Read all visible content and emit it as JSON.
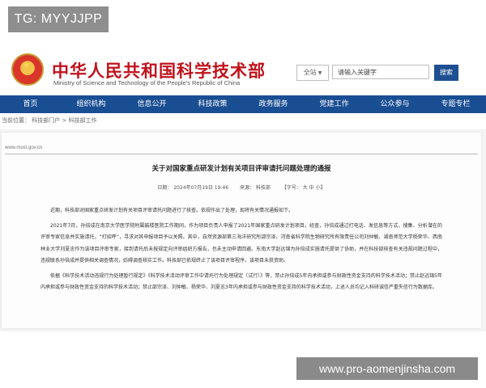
{
  "tag": "TG: MYYJJPP",
  "header": {
    "title": "中华人民共和国科学技术部",
    "subtitle": "Ministry of Science and Technology of the People's Republic of China",
    "search": {
      "scope": "全站",
      "placeholder": "请输入关键字",
      "button": "搜索"
    }
  },
  "nav": {
    "items": [
      "首页",
      "组织机构",
      "信息公开",
      "科技政策",
      "政务服务",
      "党建工作",
      "公众参与",
      "专题专栏"
    ]
  },
  "breadcrumb": "当前位置： 科技部门户 > 科技部工作",
  "document": {
    "url": "www.most.gov.cn",
    "title": "关于对国家重点研发计划有关项目评审请托问题处理的通报",
    "meta": {
      "date": "日期： 2024年07月19日  19:46",
      "source": "来源： 科技部",
      "font": "【字号： 大 中 小】"
    },
    "paragraphs": [
      "近期，科技部对国家重点研发计划有关项目评审请托问题进行了核查。依规作出了处理，现将有关情况通报如下。",
      "2021年7月，孙倍成在南京大学医学院附属鼓楼医院工作期间，作为项目负责人申报了2021年国家重点研发计划项目。经查，孙倍成通过打电话、发信息等方式，搜集、分析潜在的评审专家信息并实施请托，“打招呼”，寻求对其申报项目予以关照。其中，自然资源部第三海洋研究所邵宗泽、河南省科学院生物研究所有限责任公司刘仲敏、湖南师范大学杨荣华、西南林业大学刘夏忠作为该项目评审专家，接到请托后未按规定向评审组织方报告，也未主动申请回避。东南大学赵远锦为孙倍成实施请托提供了协助，并在科技部核查有关违规问题过程中，违规联系孙倍成并提供相关调查情况，妨碍调查核实工作。科技部已依规终止了该项目评审程序，该项目未获资助。",
      "依据《科学技术活动违规行为处理暂行规定》《科学技术活动评审工作中请托行为处理规定（试行）》等，禁止孙倍成5年内承担或参与财政性资金支持的科学技术活动；禁止赵远锦5年内承担或参与财政性资金支持的科学技术活动；禁止邵宗泽、刘仲敏、杨荣华、刘夏忠3年内承担或参与财政性资金支持的科学技术活动，上述人员均记入科研诚信严重失信行为数据库。"
    ]
  },
  "watermark": "www.pro-aomenjinsha.com"
}
